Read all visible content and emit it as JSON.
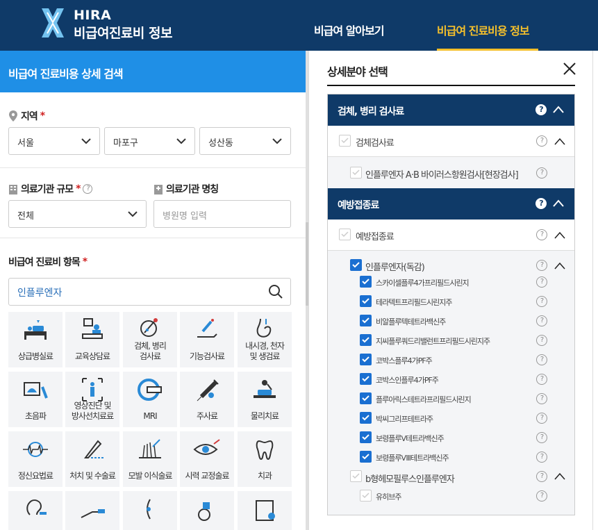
{
  "header": {
    "logo_top": "HIRA",
    "logo_bottom": "비급여진료비 정보",
    "nav": [
      {
        "label": "비급여 알아보기"
      },
      {
        "label": "비급여 진료비용 정보"
      }
    ]
  },
  "left": {
    "title": "비급여 진료비용 상세 검색",
    "region_label": "지역",
    "required": "*",
    "region": [
      "서울",
      "마포구",
      "성산동"
    ],
    "size_label": "의료기관 규모",
    "size_value": "전체",
    "name_label": "의료기관 명칭",
    "name_placeholder": "병원명 입력",
    "item_label": "비급여 진료비 항목",
    "search_value": "인플루엔자",
    "tiles": [
      {
        "label": "상급병실료"
      },
      {
        "label": "교육상담료"
      },
      {
        "label": "검체, 병리\n검사료"
      },
      {
        "label": "기능검사료"
      },
      {
        "label": "내시경, 천자\n및 생검료"
      },
      {
        "label": "초음파"
      },
      {
        "label": "영상진단 및\n방사선치료료"
      },
      {
        "label": "MRI"
      },
      {
        "label": "주사료"
      },
      {
        "label": "물리치료"
      },
      {
        "label": "정신요법료"
      },
      {
        "label": "처치 및 수술료"
      },
      {
        "label": "모발 이식술료"
      },
      {
        "label": "시력 교정술료"
      },
      {
        "label": "치과"
      }
    ]
  },
  "panel": {
    "title": "상세분야 선택",
    "help": "?",
    "sections": [
      {
        "title": "검체, 병리 검사료",
        "rows": [
          {
            "label": "검체검사료",
            "checked": false
          },
          {
            "label": "인플루엔자 A·B 바이러스항원검사[현장검사]",
            "checked": false
          }
        ]
      },
      {
        "title": "예방접종료",
        "rows": [
          {
            "label": "예방접종료",
            "checked": false
          },
          {
            "label": "인플루엔자(독감)",
            "checked": true
          },
          {
            "label": "스카이셀플루4가프리필드시린지",
            "checked": true
          },
          {
            "label": "테라텍트프리필드시린지주",
            "checked": true
          },
          {
            "label": "비알플루텍테트라백신주",
            "checked": true
          },
          {
            "label": "지씨플루쿼드리밸런트프리필드시린지주",
            "checked": true
          },
          {
            "label": "코박스플루4가PF주",
            "checked": true
          },
          {
            "label": "코박스인플루4가PF주",
            "checked": true
          },
          {
            "label": "플루아릭스테트라프리필드시린지",
            "checked": true
          },
          {
            "label": "박씨그리프테트라주",
            "checked": true
          },
          {
            "label": "보령플루Ⅴ테트라백신주",
            "checked": true
          },
          {
            "label": "보령플루Ⅷ테트라백신주",
            "checked": true
          },
          {
            "label": "b형헤모필루스인플루엔자",
            "checked": false
          },
          {
            "label": "유히브주",
            "checked": false
          }
        ]
      }
    ]
  },
  "colors": {
    "navy": "#0f3a68",
    "accent": "#f5c02b",
    "blue": "#1f8fe6",
    "check": "#1a6fd1"
  }
}
